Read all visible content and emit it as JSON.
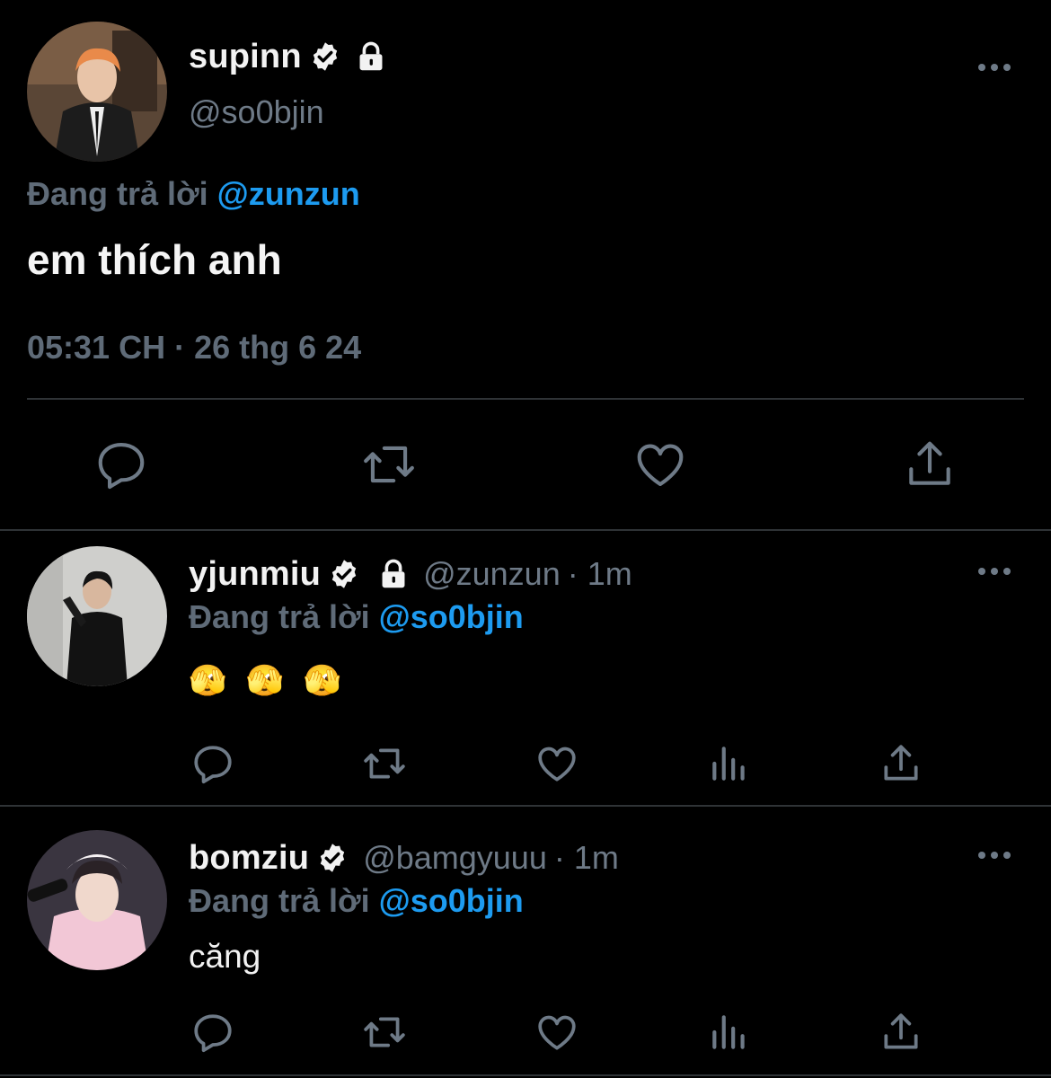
{
  "main_tweet": {
    "display_name": "supinn",
    "handle": "@so0bjin",
    "replying_label": "Đang trả lời",
    "replying_to": "@zunzun",
    "text": "em thích anh",
    "timestamp": "05:31 CH · 26 thg 6 24"
  },
  "replies": [
    {
      "display_name": "yjunmiu",
      "handle": "@zunzun",
      "time": "· 1m",
      "replying_label": "Đang trả lời",
      "replying_to": "@so0bjin",
      "text": "🫣 🫣 🫣"
    },
    {
      "display_name": "bomziu",
      "handle": "@bamgyuuu",
      "time": "· 1m",
      "replying_label": "Đang trả lời",
      "replying_to": "@so0bjin",
      "text": "căng"
    }
  ],
  "icons": {
    "reply": "reply-icon",
    "retweet": "retweet-icon",
    "like": "heart-icon",
    "views": "views-icon",
    "share": "share-icon",
    "more": "more-icon",
    "verified": "verified-badge-icon",
    "protected": "lock-icon"
  },
  "colors": {
    "background": "#000000",
    "link": "#1d9bf0",
    "secondary_text": "#6e7a87",
    "divider": "#2f3336"
  }
}
